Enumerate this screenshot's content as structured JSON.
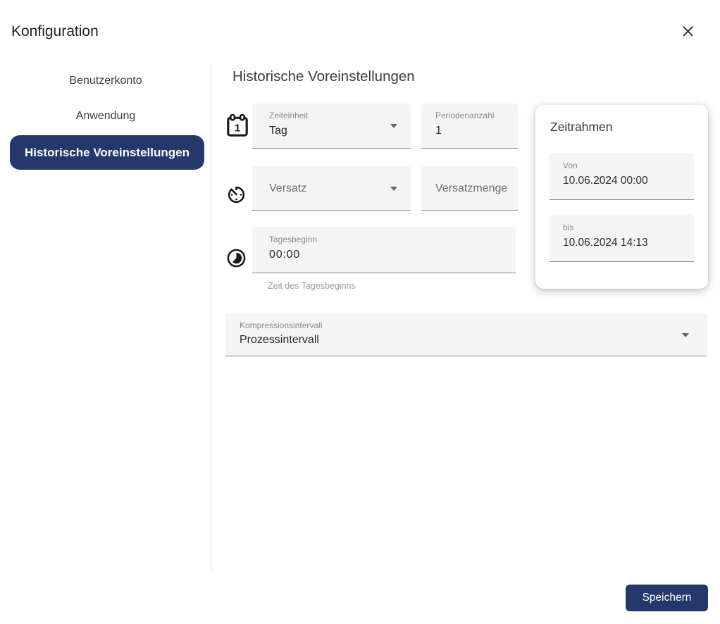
{
  "dialog": {
    "title": "Konfiguration"
  },
  "sidebar": {
    "items": [
      {
        "label": "Benutzerkonto",
        "selected": false
      },
      {
        "label": "Anwendung",
        "selected": false
      },
      {
        "label": "Historische Voreinstellungen",
        "selected": true
      }
    ]
  },
  "main": {
    "heading": "Historische Voreinstellungen",
    "fields": {
      "zeiteinheit": {
        "label": "Zeiteinheit",
        "value": "Tag"
      },
      "periodenanzahl": {
        "label": "Periodenanzahl",
        "value": "1"
      },
      "versatz": {
        "label": "Versatz",
        "value": ""
      },
      "versatzmenge": {
        "label": "Versatzmenge",
        "value": ""
      },
      "tagesbeginn": {
        "label": "Tagesbeginn",
        "value": "00:00",
        "helper": "Zeit des Tagesbeginns"
      },
      "kompressionsintervall": {
        "label": "Kompressionsintervall",
        "value": "Prozessintervall"
      }
    },
    "zeitrahmen_card": {
      "title": "Zeitrahmen",
      "von": {
        "label": "Von",
        "value": "10.06.2024 00:00"
      },
      "bis": {
        "label": "bis",
        "value": "10.06.2024 14:13"
      }
    },
    "save_button": "Speichern"
  },
  "icons": {
    "close": "x-cross",
    "calendar_one": "calendar-with-digit-1",
    "timer": "stopwatch-av-timer",
    "day_start": "timelapse-half-moon",
    "dropdown": "filled-triangle-down"
  },
  "colors": {
    "accent_navy": "#24386B",
    "field_bg": "#f4f4f4",
    "field_underline": "#8a8a8a",
    "divider": "#d8d8d8",
    "label_gray": "#8a8a8a",
    "text_dark": "#2b2b2b"
  }
}
